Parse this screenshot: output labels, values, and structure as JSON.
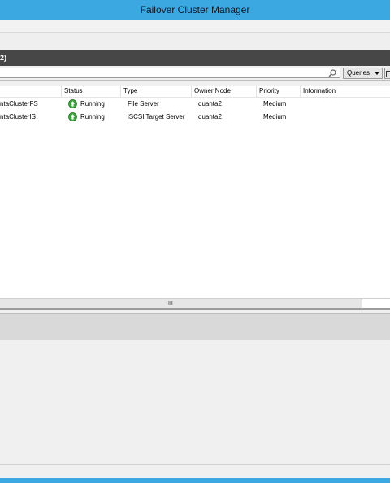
{
  "window": {
    "title": "Failover Cluster Manager"
  },
  "pane": {
    "header_text": "2)"
  },
  "toolbar": {
    "queries_label": "Queries"
  },
  "columns": [
    "Status",
    "Type",
    "Owner Node",
    "Priority",
    "Information"
  ],
  "rows": [
    {
      "name": "ntaClusterFS",
      "status": "Running",
      "type": "File Server",
      "owner": "quanta2",
      "priority": "Medium",
      "information": ""
    },
    {
      "name": "ntaClusterIS",
      "status": "Running",
      "type": "iSCSI Target Server",
      "owner": "quanta2",
      "priority": "Medium",
      "information": ""
    }
  ],
  "scrollbar": {
    "grip": "III"
  },
  "colors": {
    "titlebar": "#3ca8e2",
    "pane_header": "#474747",
    "running_icon": "#3aa53a"
  },
  "icons": {
    "search": "search-icon",
    "running": "running-up-arrow-icon",
    "dropdown": "chevron-down-icon",
    "save": "save-icon"
  }
}
